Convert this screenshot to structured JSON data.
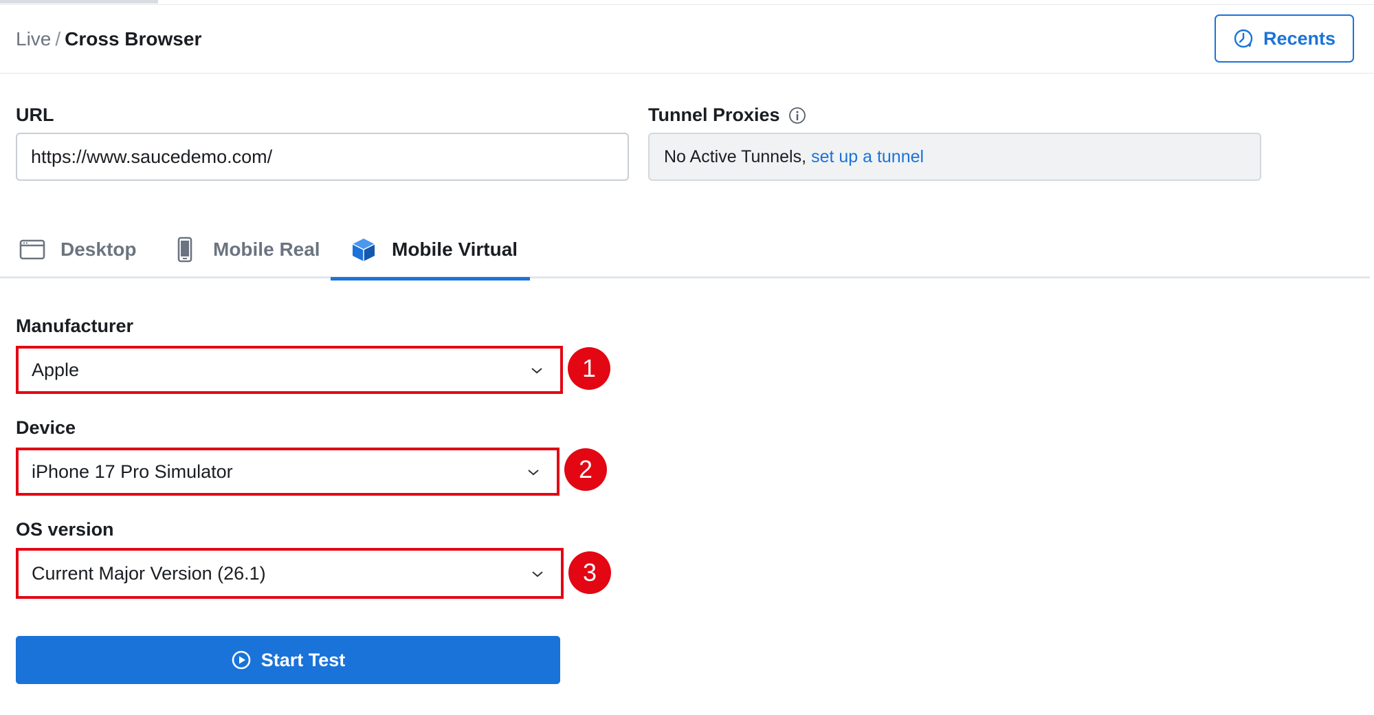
{
  "breadcrumb": {
    "parent": "Live",
    "separator": "/",
    "current": "Cross Browser"
  },
  "header": {
    "recents_label": "Recents"
  },
  "url": {
    "label": "URL",
    "value": "https://www.saucedemo.com/"
  },
  "tunnel": {
    "label": "Tunnel Proxies",
    "status": "No Active Tunnels,",
    "link": "set up a tunnel"
  },
  "tabs": [
    {
      "label": "Desktop",
      "icon": "browser-window-icon",
      "active": false
    },
    {
      "label": "Mobile Real",
      "icon": "mobile-phone-icon",
      "active": false
    },
    {
      "label": "Mobile Virtual",
      "icon": "cube-icon",
      "active": true
    }
  ],
  "form": {
    "manufacturer": {
      "label": "Manufacturer",
      "value": "Apple",
      "badge": "1"
    },
    "device": {
      "label": "Device",
      "value": "iPhone 17 Pro Simulator",
      "badge": "2"
    },
    "os_version": {
      "label": "OS version",
      "value": "Current Major Version (26.1)",
      "badge": "3"
    }
  },
  "start_button": {
    "label": "Start Test"
  },
  "colors": {
    "accent": "#1a73d9",
    "highlight": "#e30613",
    "muted_text": "#6b7480"
  }
}
